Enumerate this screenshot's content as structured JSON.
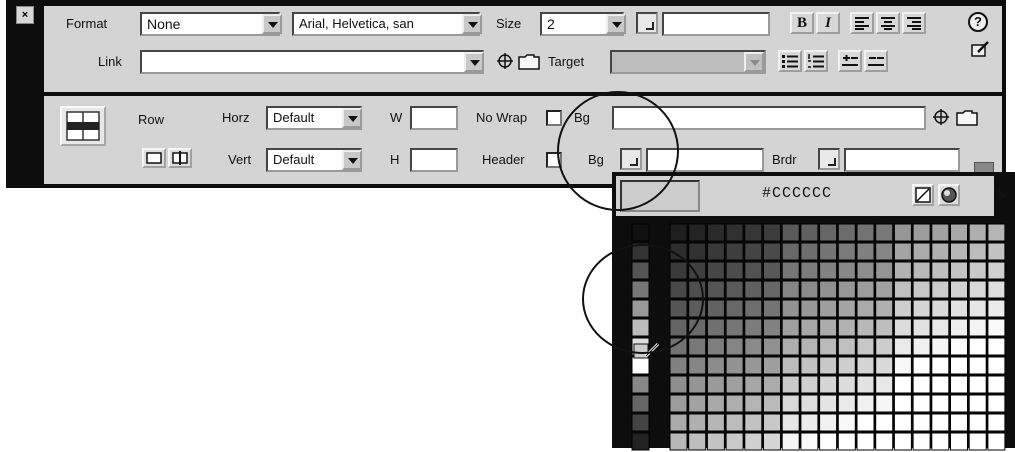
{
  "format_row": {
    "format_label": "Format",
    "format_value": "None",
    "font_value": "Arial, Helvetica, san",
    "size_label": "Size",
    "size_value": "2",
    "bold_label": "B",
    "italic_label": "I"
  },
  "link_row": {
    "link_label": "Link",
    "link_value": "",
    "target_label": "Target",
    "target_value": ""
  },
  "row_props": {
    "row_label": "Row",
    "horz_label": "Horz",
    "horz_value": "Default",
    "vert_label": "Vert",
    "vert_value": "Default",
    "w_label": "W",
    "w_value": "",
    "h_label": "H",
    "h_value": "",
    "nowrap_label": "No Wrap",
    "header_label": "Header",
    "bg_image_label": "Bg",
    "bg_image_value": "",
    "bg_color_label": "Bg",
    "bg_color_value": "",
    "brdr_label": "Brdr",
    "brdr_value": ""
  },
  "color_popup": {
    "hex_value": "#CCCCCC",
    "preview_color": "#cccccc"
  },
  "icons": [
    "close-icon",
    "help-icon",
    "edit-icon",
    "point-to-file-icon",
    "folder-icon",
    "bold-icon",
    "italic-icon",
    "align-left-icon",
    "align-center-icon",
    "align-right-icon",
    "unordered-list-icon",
    "ordered-list-icon",
    "outdent-icon",
    "indent-icon",
    "table-row-icon",
    "merge-cells-icon",
    "split-cells-icon",
    "no-color-icon",
    "system-color-icon",
    "popup-menu-arrow-icon",
    "eyedropper-icon"
  ],
  "colors": {
    "panel_bg": "#d4d4d4",
    "frame": "#0d0d0d"
  }
}
